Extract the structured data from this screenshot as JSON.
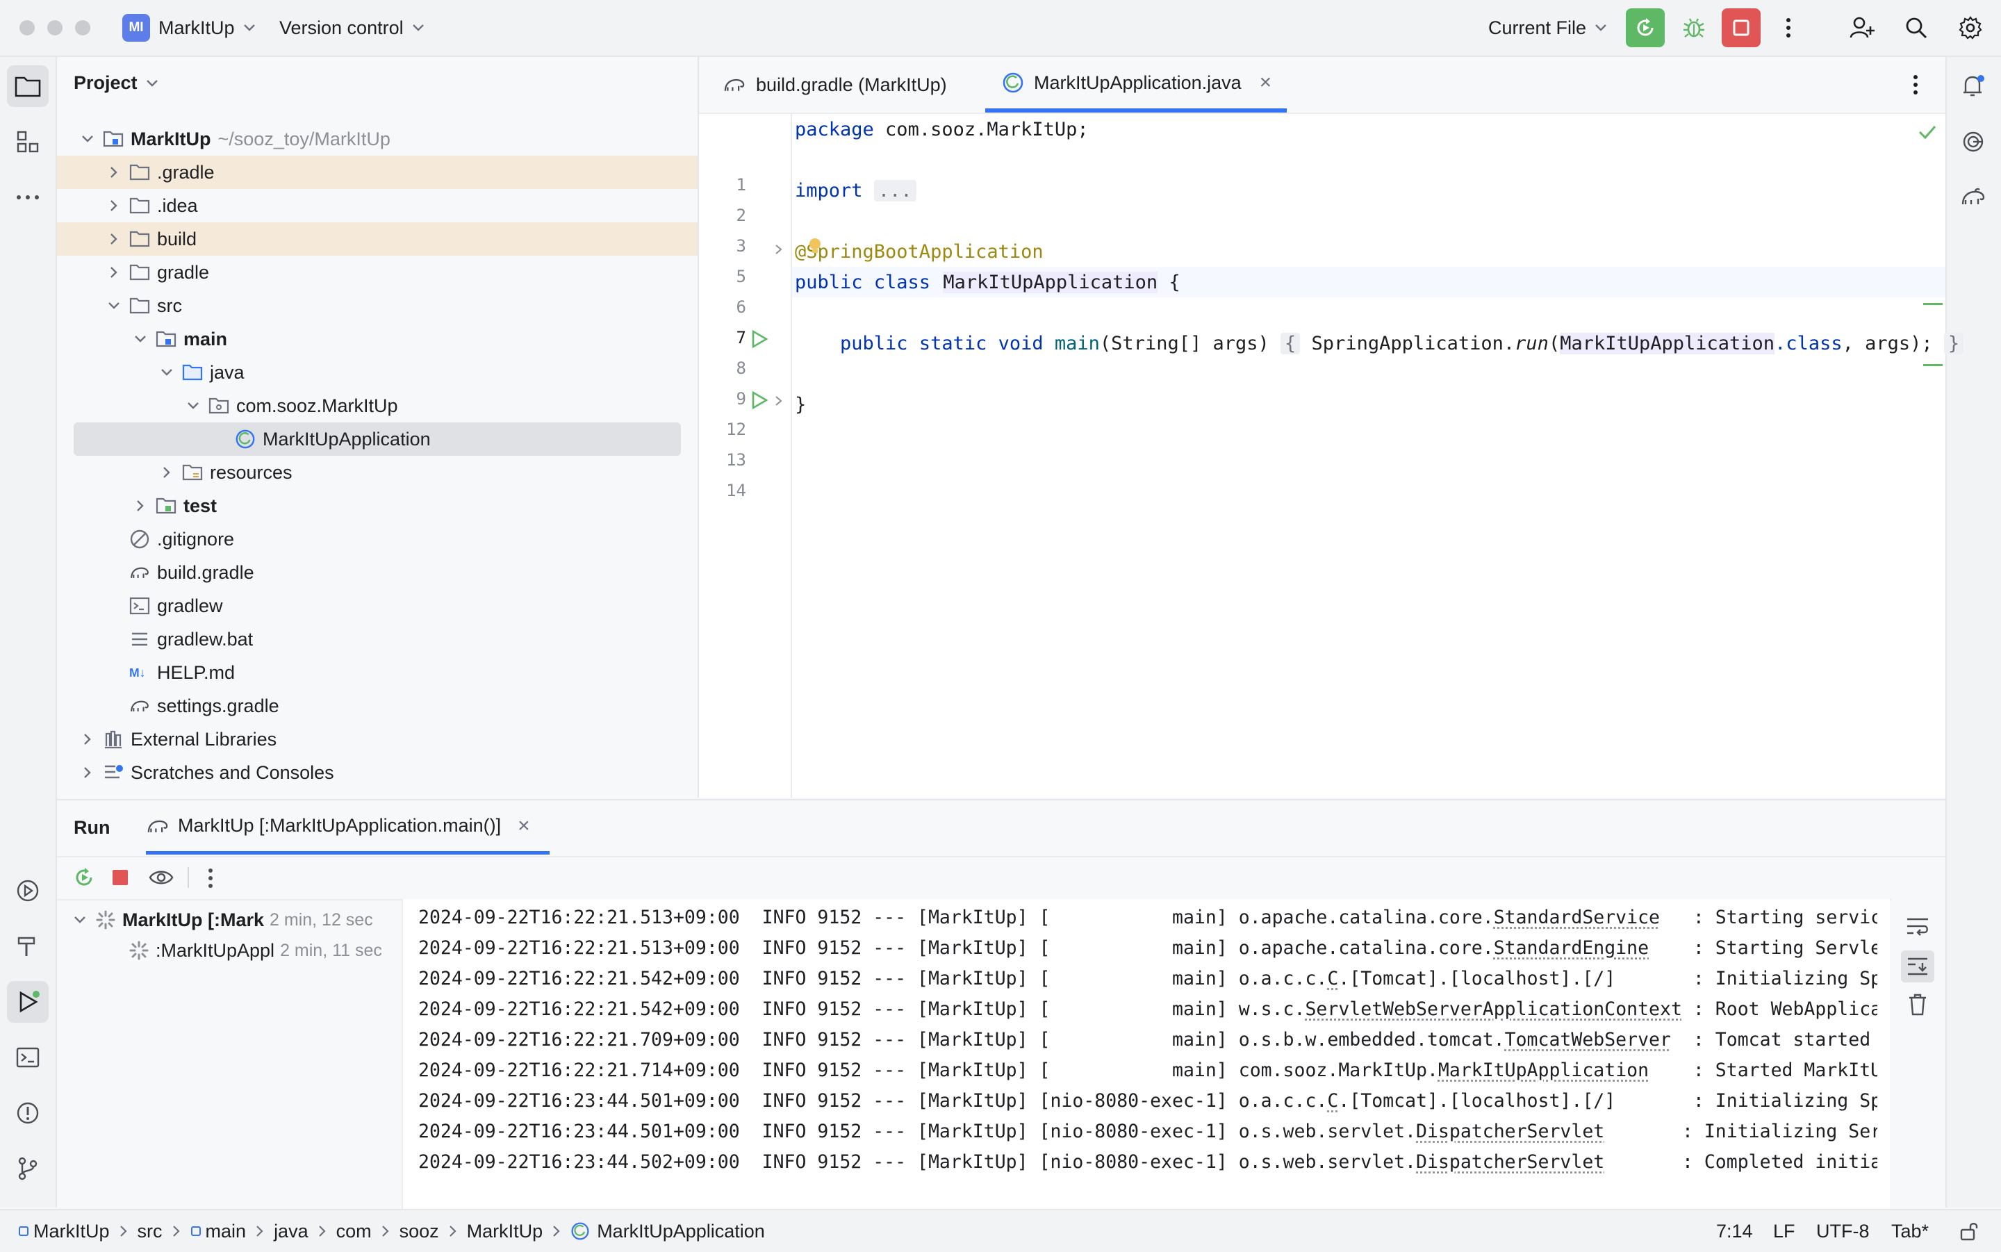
{
  "titlebar": {
    "project_badge": "MI",
    "project_name": "MarkItUp",
    "vcs_label": "Version control",
    "run_config": "Current File",
    "colors": {
      "run_green": "#5fb865",
      "stop_red": "#e05555",
      "accent": "#3574f0"
    }
  },
  "project_panel": {
    "title": "Project",
    "tree": [
      {
        "label": "MarkItUp",
        "hint": "~/sooz_toy/MarkItUp",
        "icon": "module-folder-icon",
        "expanded": true,
        "bold": true
      },
      {
        "label": ".gradle",
        "icon": "folder-icon",
        "excluded": true
      },
      {
        "label": ".idea",
        "icon": "folder-icon"
      },
      {
        "label": "build",
        "icon": "folder-icon",
        "excluded": true
      },
      {
        "label": "gradle",
        "icon": "folder-icon"
      },
      {
        "label": "src",
        "icon": "folder-icon",
        "expanded": true
      },
      {
        "label": "main",
        "icon": "source-root-folder-icon",
        "expanded": true,
        "bold": true
      },
      {
        "label": "java",
        "icon": "java-source-folder-icon",
        "expanded": true
      },
      {
        "label": "com.sooz.MarkItUp",
        "icon": "package-icon",
        "expanded": true
      },
      {
        "label": "MarkItUpApplication",
        "icon": "spring-boot-class-icon",
        "selected": true
      },
      {
        "label": "resources",
        "icon": "resources-folder-icon"
      },
      {
        "label": "test",
        "icon": "test-folder-icon",
        "bold": true
      },
      {
        "label": ".gitignore",
        "icon": "ignore-file-icon"
      },
      {
        "label": "build.gradle",
        "icon": "gradle-file-icon"
      },
      {
        "label": "gradlew",
        "icon": "shell-script-icon"
      },
      {
        "label": "gradlew.bat",
        "icon": "text-file-icon"
      },
      {
        "label": "HELP.md",
        "icon": "markdown-file-icon"
      },
      {
        "label": "settings.gradle",
        "icon": "gradle-file-icon"
      },
      {
        "label": "External Libraries",
        "icon": "libraries-icon"
      },
      {
        "label": "Scratches and Consoles",
        "icon": "scratches-icon"
      }
    ]
  },
  "editor": {
    "tabs": [
      {
        "label": "build.gradle (MarkItUp)",
        "icon": "gradle-file-icon",
        "active": false
      },
      {
        "label": "MarkItUpApplication.java",
        "icon": "spring-boot-class-icon",
        "active": true,
        "close": "×"
      }
    ],
    "line_numbers": [
      "1",
      "2",
      "3",
      "5",
      "6",
      "7",
      "8",
      "9",
      "12",
      "13",
      "14"
    ],
    "current_line": "7",
    "code": {
      "l1_kw": "package",
      "l1_rest": " com.sooz.MarkItUp;",
      "l3_kw": "import",
      "l3_fold": "...",
      "l6": "@SpringBootApplication",
      "l7_kw": "public class ",
      "l7_name": "MarkItUpApplication",
      "l7_rest": " {",
      "l9_kw": "public static void ",
      "l9_meth": "main",
      "l9_params": "(String[] args)",
      "l9_fold_open": "{",
      "l9_call": " SpringApplication.",
      "l9_run": "run",
      "l9_paren": "(",
      "l9_ref": "MarkItUpApplication",
      "l9_class": ".class",
      "l9_end": ", args);",
      "l9_fold_close": "}",
      "l13": "}"
    }
  },
  "run_panel": {
    "title": "Run",
    "tab_label": "MarkItUp [:MarkItUpApplication.main()]",
    "tab_close": "×",
    "tree": [
      {
        "label": "MarkItUp [:Mark",
        "time": "2 min, 12 sec",
        "bold": true
      },
      {
        "label": ":MarkItUpAppl",
        "time": "2 min, 11 sec",
        "bold": false
      }
    ],
    "log": [
      {
        "ts": "2024-09-22T16:22:21.513+09:00",
        "lvl": "INFO",
        "pid": "9152",
        "app": "[MarkItUp]",
        "thread": "[           main]",
        "logger_pre": "o.apache.catalina.core.",
        "logger_cls": "StandardService",
        "pad": "   ",
        "msg": ": Starting service [Tomcat]"
      },
      {
        "ts": "2024-09-22T16:22:21.513+09:00",
        "lvl": "INFO",
        "pid": "9152",
        "app": "[MarkItUp]",
        "thread": "[           main]",
        "logger_pre": "o.apache.catalina.core.",
        "logger_cls": "StandardEngine",
        "pad": "    ",
        "msg": ": Starting Servlet engine"
      },
      {
        "ts": "2024-09-22T16:22:21.542+09:00",
        "lvl": "INFO",
        "pid": "9152",
        "app": "[MarkItUp]",
        "thread": "[           main]",
        "logger_pre": "o.a.c.c.",
        "logger_cls": "C",
        "logger_post": ".[Tomcat].[localhost].[/]",
        "pad": "       ",
        "msg": ": Initializing Spring"
      },
      {
        "ts": "2024-09-22T16:22:21.542+09:00",
        "lvl": "INFO",
        "pid": "9152",
        "app": "[MarkItUp]",
        "thread": "[           main]",
        "logger_pre": "w.s.c.",
        "logger_cls": "ServletWebServerApplicationContext",
        "pad": " ",
        "msg": ": Root WebApplication"
      },
      {
        "ts": "2024-09-22T16:22:21.709+09:00",
        "lvl": "INFO",
        "pid": "9152",
        "app": "[MarkItUp]",
        "thread": "[           main]",
        "logger_pre": "o.s.b.w.embedded.tomcat.",
        "logger_cls": "TomcatWebServer",
        "pad": "  ",
        "msg": ": Tomcat started on p"
      },
      {
        "ts": "2024-09-22T16:22:21.714+09:00",
        "lvl": "INFO",
        "pid": "9152",
        "app": "[MarkItUp]",
        "thread": "[           main]",
        "logger_pre": "com.sooz.MarkItUp.",
        "logger_cls": "MarkItUpApplication",
        "pad": "    ",
        "msg": ": Started MarkItUpApp"
      },
      {
        "ts": "2024-09-22T16:23:44.501+09:00",
        "lvl": "INFO",
        "pid": "9152",
        "app": "[MarkItUp]",
        "thread": "[nio-8080-exec-1]",
        "logger_pre": "o.a.c.c.",
        "logger_cls": "C",
        "logger_post": ".[Tomcat].[localhost].[/]",
        "pad": "       ",
        "msg": ": Initializing Spring"
      },
      {
        "ts": "2024-09-22T16:23:44.501+09:00",
        "lvl": "INFO",
        "pid": "9152",
        "app": "[MarkItUp]",
        "thread": "[nio-8080-exec-1]",
        "logger_pre": "o.s.web.servlet.",
        "logger_cls": "DispatcherServlet",
        "pad": "       ",
        "msg": ": Initializing Servle"
      },
      {
        "ts": "2024-09-22T16:23:44.502+09:00",
        "lvl": "INFO",
        "pid": "9152",
        "app": "[MarkItUp]",
        "thread": "[nio-8080-exec-1]",
        "logger_pre": "o.s.web.servlet.",
        "logger_cls": "DispatcherServlet",
        "pad": "       ",
        "msg": ": Completed initializ"
      }
    ]
  },
  "statusbar": {
    "breadcrumb": [
      "MarkItUp",
      "src",
      "main",
      "java",
      "com",
      "sooz",
      "MarkItUp",
      "MarkItUpApplication"
    ],
    "position": "7:14",
    "line_sep": "LF",
    "encoding": "UTF-8",
    "indent": "Tab*"
  }
}
